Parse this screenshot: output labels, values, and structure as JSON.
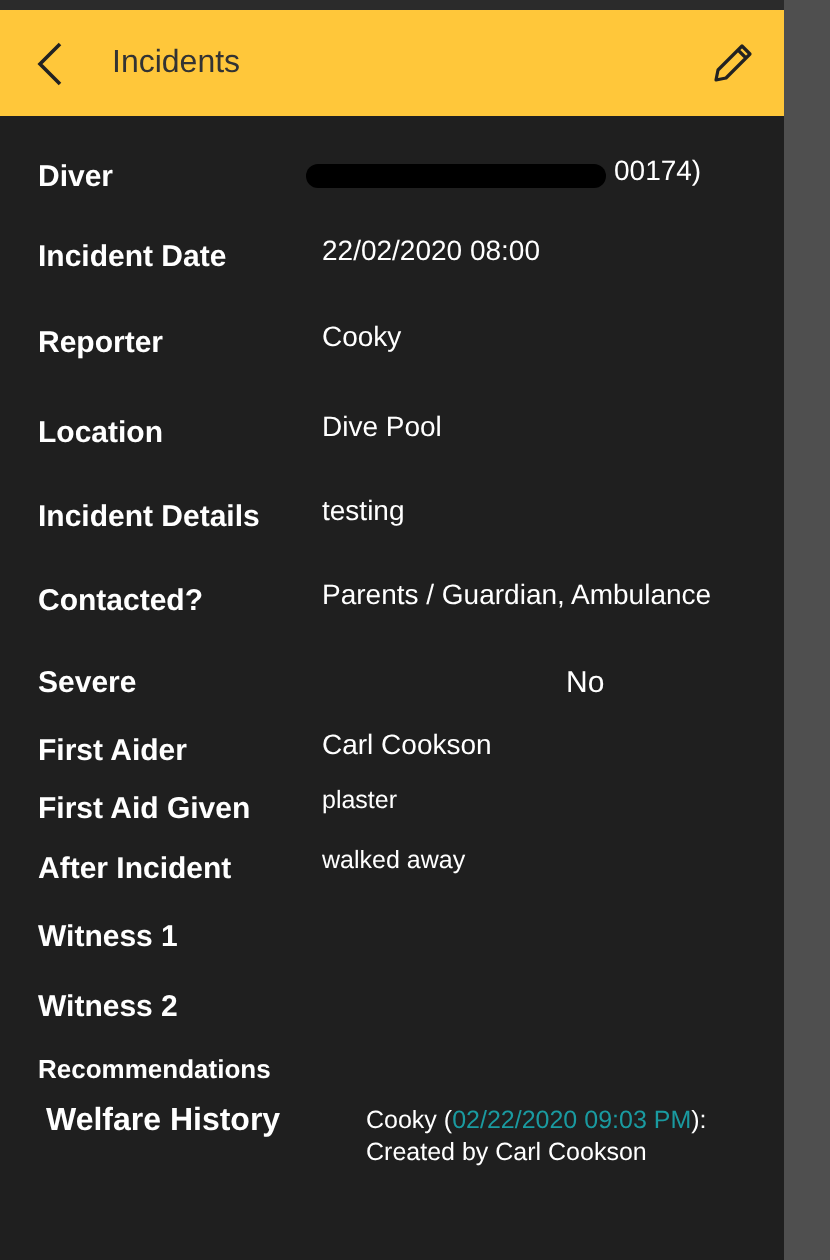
{
  "header": {
    "title": "Incidents"
  },
  "fields": [
    {
      "label": "Diver",
      "value": "00174)",
      "redacted": true
    },
    {
      "label": "Incident Date",
      "value": "22/02/2020 08:00"
    },
    {
      "label": "Reporter",
      "value": "Cooky"
    },
    {
      "label": "Location",
      "value": "Dive Pool"
    },
    {
      "label": "Incident Details",
      "value": "testing"
    },
    {
      "label": "Contacted?",
      "value": "Parents / Guardian,  Ambulance"
    },
    {
      "label": "Severe",
      "value": "No",
      "kind": "centered"
    },
    {
      "label": "First Aider",
      "value": "Carl Cookson"
    },
    {
      "label": "First Aid Given",
      "value": "plaster",
      "kind": "small"
    },
    {
      "label": "After Incident",
      "value": "walked away",
      "kind": "small"
    },
    {
      "label": "Witness 1"
    },
    {
      "label": "Witness 2"
    },
    {
      "label": "Recommendations",
      "kind": "minor"
    }
  ],
  "welfare_history": {
    "label": "Welfare History",
    "author": "Cooky (",
    "timestamp": "02/22/2020 09:03 PM",
    "after_timestamp": "):",
    "note": "Created by Carl Cookson"
  }
}
